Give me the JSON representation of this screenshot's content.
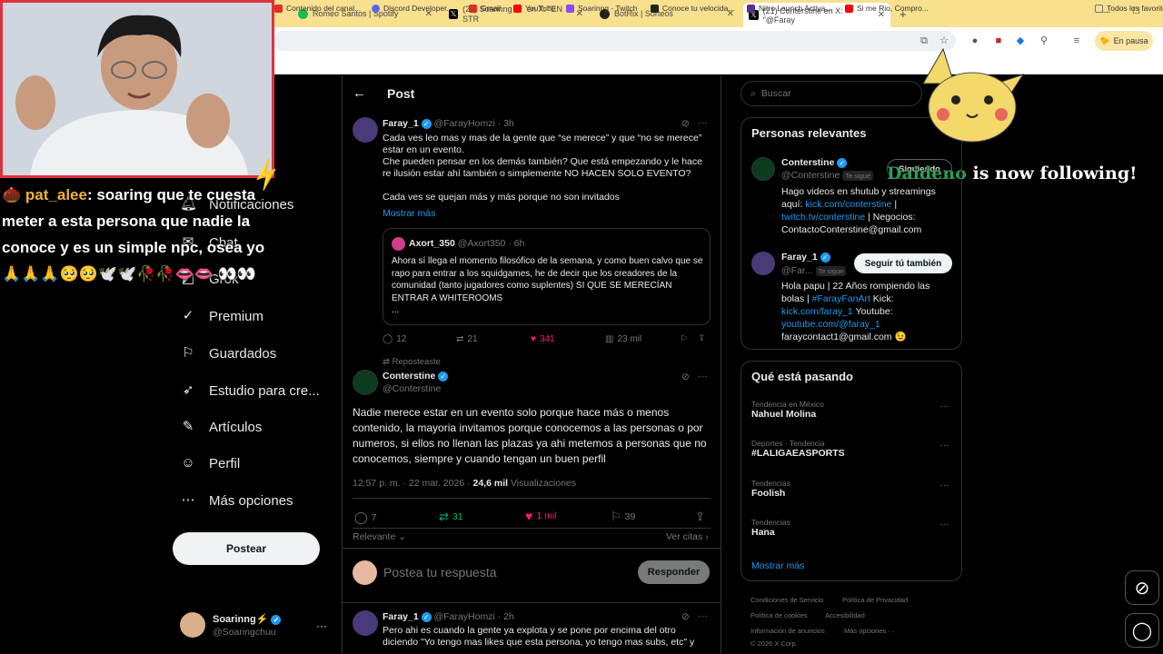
{
  "browser": {
    "tabs": [
      {
        "label": "Romeo Santos | Spotify",
        "color": "#1db954"
      },
      {
        "label": "(21) Soarinng ⚡ en X: \"EN STR",
        "color": "#000000"
      },
      {
        "label": "BotRix | Sorteos",
        "color": "#222222"
      },
      {
        "label": "(21) Conterstine en X: \"@Faray",
        "color": "#000000"
      }
    ],
    "new_tab": "+",
    "pause_label": "En pausa",
    "bookmarks": [
      {
        "label": "Contenido del canal...",
        "color": "#e52d27"
      },
      {
        "label": "Discord Developer...",
        "color": "#5865f2"
      },
      {
        "label": "Gmail",
        "color": "#d93025"
      },
      {
        "label": "YouTube",
        "color": "#ff0000"
      },
      {
        "label": "Soarinng - Twitch",
        "color": "#9146ff"
      },
      {
        "label": "Conoce tu velocida...",
        "color": "#222222"
      },
      {
        "label": "Nitro Launch Activa...",
        "color": "#5b2e91"
      },
      {
        "label": "Si me Rio, Compro...",
        "color": "#ff0000"
      },
      {
        "label": "Todos los favoritos",
        "color": "#777777"
      }
    ]
  },
  "chat": {
    "user": "pat_alee",
    "message": ": soaring que te cuesta meter a esta persona que nadie la conoce y es un simple npc, osea yo",
    "emotes": "🙏🙏🙏🥺🥺🕊️🕊️🥀🥀👄👄 👀👀"
  },
  "overlay": {
    "follow_name": "Daideno",
    "follow_text": "is now following!"
  },
  "nav": [
    {
      "label": "Notificaciones",
      "icon": "bell-icon"
    },
    {
      "label": "Chat",
      "icon": "chat-icon"
    },
    {
      "label": "Grok",
      "icon": "grok-icon"
    },
    {
      "label": "Premium",
      "icon": "premium-icon"
    },
    {
      "label": "Guardados",
      "icon": "bookmark-icon"
    },
    {
      "label": "Estudio para cre...",
      "icon": "rocket-icon"
    },
    {
      "label": "Artículos",
      "icon": "article-icon"
    },
    {
      "label": "Perfil",
      "icon": "person-icon"
    },
    {
      "label": "Más opciones",
      "icon": "more-icon"
    }
  ],
  "postear": "Postear",
  "account": {
    "name": "Soarinng⚡",
    "handle": "@Soaringchuu"
  },
  "post_header": "Post",
  "tweet1": {
    "name": "Faray_1",
    "handle": "@FarayHomzi",
    "time": "· 3h",
    "text": "Cada ves leo mas y mas de la gente que “se merece” y que “no se merece” estar en un evento.\nChe pueden pensar en los demás también? Que está empezando y le hace re ilusión estar ahí también o simplemente NO HACEN SOLO EVENTO?\n\nCada ves se quejan más y más porque no son invitados",
    "show_more": "Mostrar más",
    "quote": {
      "name": "Axort_350",
      "handle": "@Axort350",
      "time": "· 6h",
      "text": "Ahora sí llega el momento filosófico de la semana, y como buen calvo que se rapo para entrar a los squidgames, he de decir que los creadores de la comunidad (tanto jugadores como suplentes) SI QUE SE MERECÍAN ENTRAR A WHITEROOMS\n..."
    },
    "stats": {
      "replies": "12",
      "reposts": "21",
      "likes": "341",
      "views": "23 mil"
    }
  },
  "repost_label": "Reposteaste",
  "main_tweet": {
    "name": "Conterstine",
    "handle": "@Conterstine",
    "text": "Nadie merece estar en un evento solo porque hace más o menos contenido, la mayoria invitamos porque conocemos a las personas o por numeros, si ellos no llenan las plazas ya ahi metemos a personas que no conocemos, siempre y cuando tengan un buen perfil",
    "time": "12:57 p. m. · 22 mar. 2026 ·",
    "views": "24,6 mil",
    "views_label": "Visualizaciones",
    "stats": {
      "replies": "7",
      "reposts": "31",
      "likes": "1 mil",
      "bookmarks": "39"
    }
  },
  "sort": {
    "label": "Relevante",
    "quotes": "Ver citas"
  },
  "reply_box": {
    "placeholder": "Postea tu respuesta",
    "button": "Responder"
  },
  "tweet3": {
    "name": "Faray_1",
    "handle": "@FarayHomzi",
    "time": "· 2h",
    "text": "Pero ahi es cuando la gente ya explota y se pone por encima del otro diciendo \"Yo tengo mas likes que esta persona, yo tengo mas subs, etc\" y"
  },
  "search_placeholder": "Buscar",
  "relevant": {
    "title": "Personas relevantes",
    "people": [
      {
        "name": "Conterstine",
        "handle": "@Conterstine",
        "follows_you": "Te sigue",
        "button": "Siguiendo",
        "bio_pre": "Hago videos en shutub y streamings aquí: ",
        "bio_link1": "kick.com/conterstine",
        "bio_mid": " | ",
        "bio_link2": "twitch.tv/conterstine",
        "bio_post": " | Negocios: ContactoConterstine@gmail.com"
      },
      {
        "name": "Faray_1",
        "handle": "@Far...",
        "follows_you": "Te sigue",
        "button": "Seguir tú también",
        "bio_pre": "Hola papu | 22 Años rompiendo las bolas | ",
        "bio_link1": "#FarayFanArt",
        "bio_mid": " Kick: ",
        "bio_link2": "kick.com/faray_1",
        "bio_post": " Youtube: ",
        "bio_link3": "youtube.com/@faray_1",
        "bio_end": " faraycontact1@gmail.com 😉"
      }
    ]
  },
  "trends": {
    "title": "Qué está pasando",
    "items": [
      {
        "category": "Tendencia en México",
        "name": "Nahuel Molina"
      },
      {
        "category": "Deportes · Tendencia",
        "name": "#LALIGAEASPORTS"
      },
      {
        "category": "Tendencias",
        "name": "Foolish"
      },
      {
        "category": "Tendencias",
        "name": "Hana"
      }
    ],
    "show_more": "Mostrar más"
  },
  "footer": {
    "links": [
      "Condiciones de Servicio",
      "Política de Privacidad",
      "Política de cookies",
      "Accesibilidad",
      "Información de anuncios",
      "Más opciones ···"
    ],
    "copyright": "© 2026 X Corp."
  },
  "colors": {
    "accent": "#1d9bf0",
    "like": "#f91880",
    "repost": "#00ba7c",
    "stream_border": "#e0323c",
    "tabbar": "#f8e08e"
  }
}
